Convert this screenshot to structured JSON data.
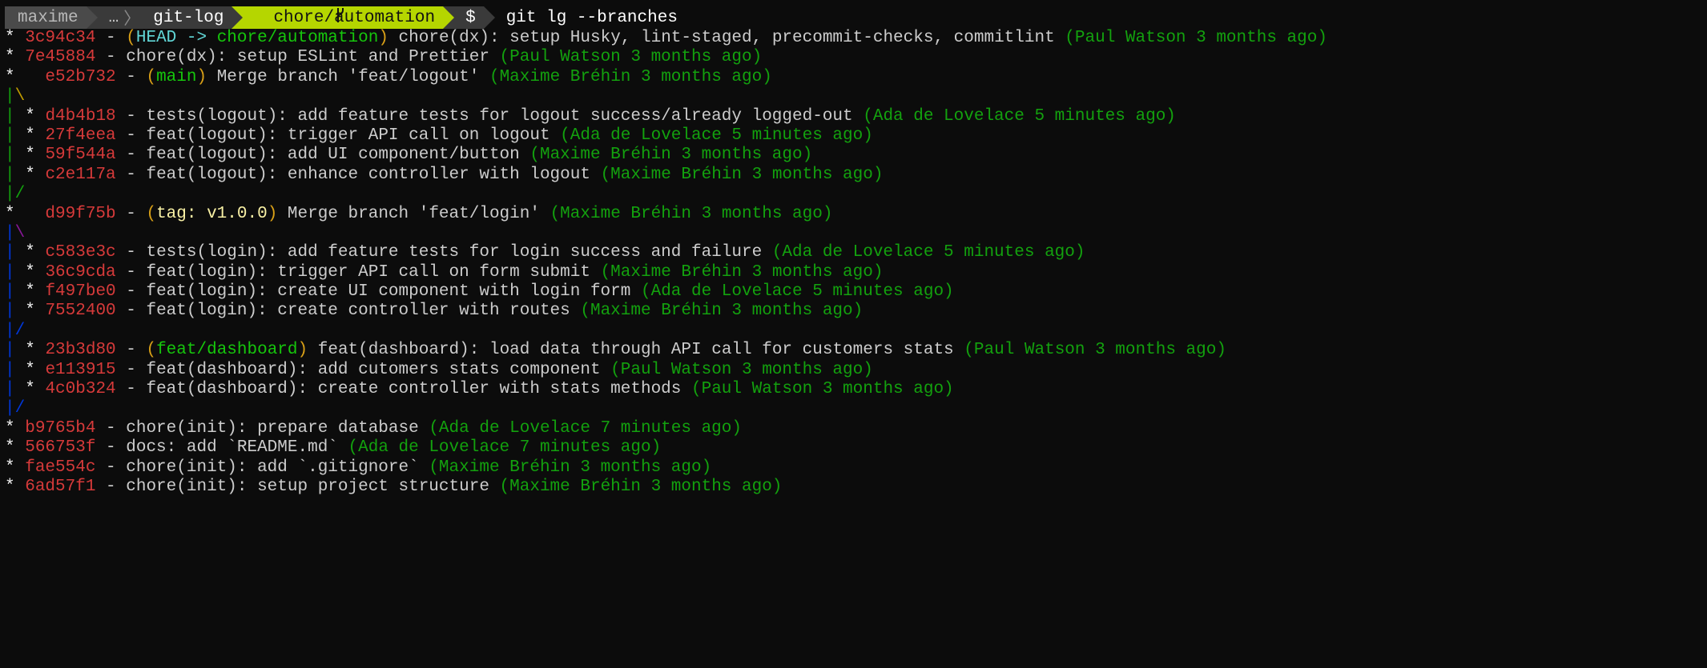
{
  "prompt": {
    "user": "maxime",
    "ellipsis": "…",
    "directory": "git-log",
    "branch_icon": "git-branch-icon",
    "branch": "chore/automation",
    "symbol": "$",
    "command": "git lg --branches"
  },
  "colors": {
    "hash": "#d63a3a",
    "author": "#13a10e",
    "branch_ref": "#16c60c",
    "head_ref": "#61d6d6",
    "tag_ref": "#f9f1a5",
    "ref_paren": "#d9a017",
    "prompt_branch_bg": "#b5d600"
  },
  "log": [
    {
      "graph": [
        {
          "t": "*",
          "c": "star"
        },
        {
          "t": " "
        }
      ],
      "hash": "3c94c34",
      "refs": [
        {
          "t": "HEAD -> ",
          "c": "head"
        },
        {
          "t": "chore/automation",
          "c": "branch"
        }
      ],
      "message": "chore(dx): setup Husky, lint-staged, precommit-checks, commitlint",
      "author_info": "(Paul Watson 3 months ago)"
    },
    {
      "graph": [
        {
          "t": "*",
          "c": "star"
        },
        {
          "t": " "
        }
      ],
      "hash": "7e45884",
      "refs": [],
      "message": "chore(dx): setup ESLint and Prettier",
      "author_info": "(Paul Watson 3 months ago)"
    },
    {
      "graph": [
        {
          "t": "*",
          "c": "star"
        },
        {
          "t": "   "
        }
      ],
      "hash": "e52b732",
      "refs": [
        {
          "t": "main",
          "c": "branch"
        }
      ],
      "message": "Merge branch 'feat/logout'",
      "author_info": "(Maxime Bréhin 3 months ago)"
    },
    {
      "graph": [
        {
          "t": "|",
          "c": "g-green"
        },
        {
          "t": "\\",
          "c": "g-yellow"
        }
      ]
    },
    {
      "graph": [
        {
          "t": "|",
          "c": "g-green"
        },
        {
          "t": " "
        },
        {
          "t": "*",
          "c": "star"
        },
        {
          "t": " "
        }
      ],
      "hash": "d4b4b18",
      "refs": [],
      "message": "tests(logout): add feature tests for logout success/already logged-out",
      "author_info": "(Ada de Lovelace 5 minutes ago)"
    },
    {
      "graph": [
        {
          "t": "|",
          "c": "g-green"
        },
        {
          "t": " "
        },
        {
          "t": "*",
          "c": "star"
        },
        {
          "t": " "
        }
      ],
      "hash": "27f4eea",
      "refs": [],
      "message": "feat(logout): trigger API call on logout",
      "author_info": "(Ada de Lovelace 5 minutes ago)"
    },
    {
      "graph": [
        {
          "t": "|",
          "c": "g-green"
        },
        {
          "t": " "
        },
        {
          "t": "*",
          "c": "star"
        },
        {
          "t": " "
        }
      ],
      "hash": "59f544a",
      "refs": [],
      "message": "feat(logout): add UI component/button",
      "author_info": "(Maxime Bréhin 3 months ago)"
    },
    {
      "graph": [
        {
          "t": "|",
          "c": "g-green"
        },
        {
          "t": " "
        },
        {
          "t": "*",
          "c": "star"
        },
        {
          "t": " "
        }
      ],
      "hash": "c2e117a",
      "refs": [],
      "message": "feat(logout): enhance controller with logout",
      "author_info": "(Maxime Bréhin 3 months ago)"
    },
    {
      "graph": [
        {
          "t": "|",
          "c": "g-green"
        },
        {
          "t": "/",
          "c": "g-green"
        }
      ]
    },
    {
      "graph": [
        {
          "t": "*",
          "c": "star"
        },
        {
          "t": "   "
        }
      ],
      "hash": "d99f75b",
      "refs": [
        {
          "t": "tag: v1.0.0",
          "c": "tag"
        }
      ],
      "message": "Merge branch 'feat/login'",
      "author_info": "(Maxime Bréhin 3 months ago)"
    },
    {
      "graph": [
        {
          "t": "|",
          "c": "g-blue"
        },
        {
          "t": "\\",
          "c": "g-purple"
        }
      ]
    },
    {
      "graph": [
        {
          "t": "|",
          "c": "g-blue"
        },
        {
          "t": " "
        },
        {
          "t": "*",
          "c": "star"
        },
        {
          "t": " "
        }
      ],
      "hash": "c583e3c",
      "refs": [],
      "message": "tests(login): add feature tests for login success and failure",
      "author_info": "(Ada de Lovelace 5 minutes ago)"
    },
    {
      "graph": [
        {
          "t": "|",
          "c": "g-blue"
        },
        {
          "t": " "
        },
        {
          "t": "*",
          "c": "star"
        },
        {
          "t": " "
        }
      ],
      "hash": "36c9cda",
      "refs": [],
      "message": "feat(login): trigger API call on form submit",
      "author_info": "(Maxime Bréhin 3 months ago)"
    },
    {
      "graph": [
        {
          "t": "|",
          "c": "g-blue"
        },
        {
          "t": " "
        },
        {
          "t": "*",
          "c": "star"
        },
        {
          "t": " "
        }
      ],
      "hash": "f497be0",
      "refs": [],
      "message": "feat(login): create UI component with login form",
      "author_info": "(Ada de Lovelace 5 minutes ago)"
    },
    {
      "graph": [
        {
          "t": "|",
          "c": "g-blue"
        },
        {
          "t": " "
        },
        {
          "t": "*",
          "c": "star"
        },
        {
          "t": " "
        }
      ],
      "hash": "7552400",
      "refs": [],
      "message": "feat(login): create controller with routes",
      "author_info": "(Maxime Bréhin 3 months ago)"
    },
    {
      "graph": [
        {
          "t": "|",
          "c": "g-blue"
        },
        {
          "t": "/",
          "c": "g-blue"
        }
      ]
    },
    {
      "graph": [
        {
          "t": "|",
          "c": "g-blue"
        },
        {
          "t": " "
        },
        {
          "t": "*",
          "c": "star"
        },
        {
          "t": " "
        }
      ],
      "hash": "23b3d80",
      "refs": [
        {
          "t": "feat/dashboard",
          "c": "branch"
        }
      ],
      "message": "feat(dashboard): load data through API call for customers stats",
      "author_info": "(Paul Watson 3 months ago)"
    },
    {
      "graph": [
        {
          "t": "|",
          "c": "g-blue"
        },
        {
          "t": " "
        },
        {
          "t": "*",
          "c": "star"
        },
        {
          "t": " "
        }
      ],
      "hash": "e113915",
      "refs": [],
      "message": "feat(dashboard): add cutomers stats component",
      "author_info": "(Paul Watson 3 months ago)"
    },
    {
      "graph": [
        {
          "t": "|",
          "c": "g-blue"
        },
        {
          "t": " "
        },
        {
          "t": "*",
          "c": "star"
        },
        {
          "t": " "
        }
      ],
      "hash": "4c0b324",
      "refs": [],
      "message": "feat(dashboard): create controller with stats methods",
      "author_info": "(Paul Watson 3 months ago)"
    },
    {
      "graph": [
        {
          "t": "|",
          "c": "g-blue"
        },
        {
          "t": "/",
          "c": "g-blue"
        }
      ]
    },
    {
      "graph": [
        {
          "t": "*",
          "c": "star"
        },
        {
          "t": " "
        }
      ],
      "hash": "b9765b4",
      "refs": [],
      "message": "chore(init): prepare database",
      "author_info": "(Ada de Lovelace 7 minutes ago)"
    },
    {
      "graph": [
        {
          "t": "*",
          "c": "star"
        },
        {
          "t": " "
        }
      ],
      "hash": "566753f",
      "refs": [],
      "message": "docs: add `README.md`",
      "author_info": "(Ada de Lovelace 7 minutes ago)"
    },
    {
      "graph": [
        {
          "t": "*",
          "c": "star"
        },
        {
          "t": " "
        }
      ],
      "hash": "fae554c",
      "refs": [],
      "message": "chore(init): add `.gitignore`",
      "author_info": "(Maxime Bréhin 3 months ago)"
    },
    {
      "graph": [
        {
          "t": "*",
          "c": "star"
        },
        {
          "t": " "
        }
      ],
      "hash": "6ad57f1",
      "refs": [],
      "message": "chore(init): setup project structure",
      "author_info": "(Maxime Bréhin 3 months ago)"
    }
  ]
}
